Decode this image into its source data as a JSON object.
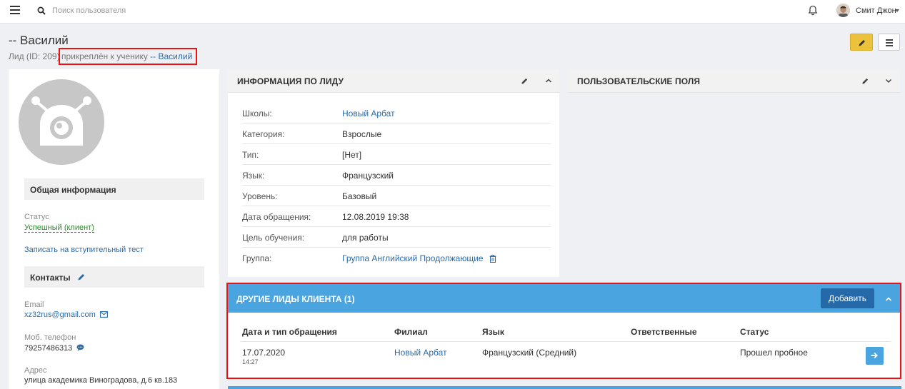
{
  "topbar": {
    "search_placeholder": "Поиск пользователя",
    "user_name": "Смит Джон"
  },
  "header": {
    "title": "-- Василий",
    "subtitle": "Лид (ID: 209)",
    "attached_prefix": "прикреплён к ученику ",
    "attached_link": "-- Василий"
  },
  "sidebar": {
    "general_title": "Общая информация",
    "status_label": "Статус",
    "status_value": "Успешный (клиент)",
    "entry_test_link": "Записать на вступительный тест",
    "contacts_title": "Контакты",
    "email_label": "Email",
    "email_value": "xz32rus@gmail.com",
    "phone_label": "Моб. телефон",
    "phone_value": "79257486313",
    "address_label": "Адрес",
    "address_value": "улица академика Виноградова, д.6 кв.183"
  },
  "lead_info": {
    "title": "ИНФОРМАЦИЯ ПО ЛИДУ",
    "rows": [
      {
        "key": "Школы:",
        "value": "Новый Арбат"
      },
      {
        "key": "Категория:",
        "value": "Взрослые"
      },
      {
        "key": "Тип:",
        "value": "[Нет]"
      },
      {
        "key": "Язык:",
        "value": "Французский"
      },
      {
        "key": "Уровень:",
        "value": "Базовый"
      },
      {
        "key": "Дата обращения:",
        "value": "12.08.2019 19:38"
      },
      {
        "key": "Цель обучения:",
        "value": "для работы"
      },
      {
        "key": "Группа:",
        "value": "Группа Английский Продолжающие"
      }
    ]
  },
  "custom_fields": {
    "title": "ПОЛЬЗОВАТЕЛЬСКИЕ ПОЛЯ"
  },
  "other_leads": {
    "title": "ДРУГИЕ ЛИДЫ КЛИЕНТА (1)",
    "add_label": "Добавить",
    "columns": [
      "Дата и тип обращения",
      "Филиал",
      "Язык",
      "Ответственные",
      "Статус"
    ],
    "row": {
      "date": "17.07.2020",
      "time": "14:27",
      "branch": "Новый Арбат",
      "language": "Французский (Средний)",
      "responsible": "",
      "status": "Прошел пробное"
    }
  },
  "colors": {
    "accent_blue": "#49a4e0",
    "button_blue": "#2669a8",
    "edit_yellow": "#ecc13c",
    "highlight_red": "#ee1111"
  }
}
